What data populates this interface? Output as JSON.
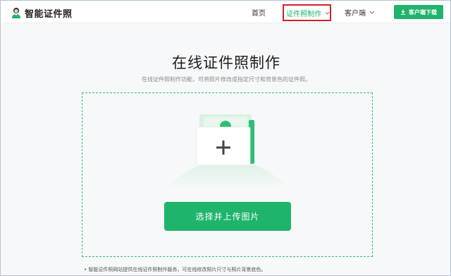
{
  "header": {
    "logo_text": "智能证件照",
    "nav": {
      "home": "首页",
      "id_photo": "证件照制作",
      "client": "客户端"
    },
    "download_button": "客户端下载"
  },
  "main": {
    "title": "在线证件照制作",
    "subtitle": "在线证件照制作功能，可将照片修改成指定尺寸和背景色的证件照。",
    "upload_button": "选择并上传图片",
    "footer_note": "• 智能证件照网站提供在线证件照制作服务，可在线修改照片尺寸与照片背景底色。"
  },
  "colors": {
    "accent": "#1fb46b",
    "highlight_box": "#d0212b"
  },
  "icons": [
    "logo-person-icon",
    "chevron-down-icon",
    "download-icon",
    "plus-icon",
    "person-icon"
  ]
}
